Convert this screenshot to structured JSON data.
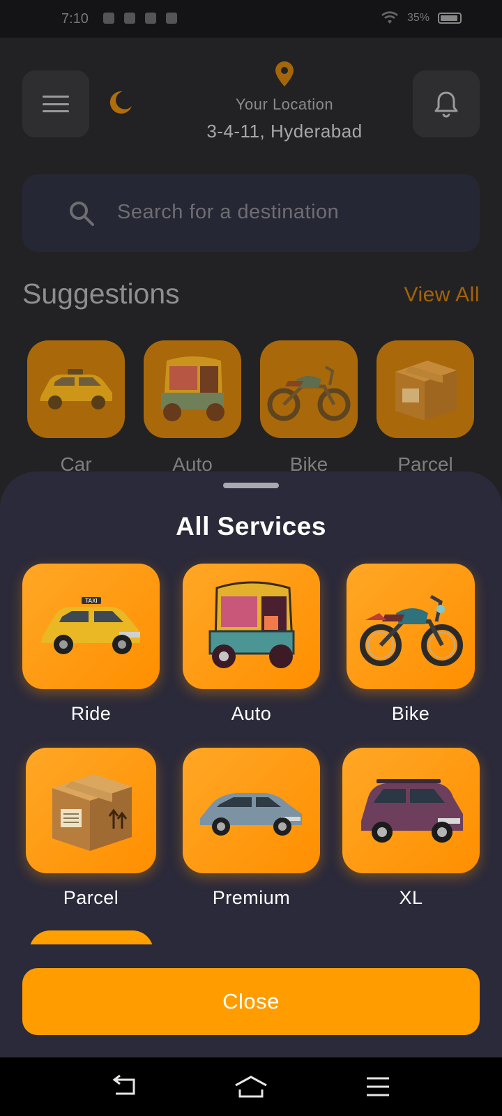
{
  "status_bar": {
    "time": "7:10",
    "battery": "35%"
  },
  "header": {
    "location_label": "Your Location",
    "location_address": "3-4-11, Hyderabad"
  },
  "search": {
    "placeholder": "Search for a destination"
  },
  "suggestions": {
    "title": "Suggestions",
    "view_all": "View All",
    "items": [
      {
        "label": "Car",
        "icon": "taxi-car-icon"
      },
      {
        "label": "Auto",
        "icon": "auto-rickshaw-icon"
      },
      {
        "label": "Bike",
        "icon": "motorbike-icon"
      },
      {
        "label": "Parcel",
        "icon": "parcel-box-icon"
      }
    ]
  },
  "sheet": {
    "title": "All Services",
    "services": [
      {
        "label": "Ride",
        "icon": "taxi-car-icon"
      },
      {
        "label": "Auto",
        "icon": "auto-rickshaw-icon"
      },
      {
        "label": "Bike",
        "icon": "motorbike-icon"
      },
      {
        "label": "Parcel",
        "icon": "parcel-box-icon"
      },
      {
        "label": "Premium",
        "icon": "sedan-car-icon"
      },
      {
        "label": "XL",
        "icon": "suv-car-icon"
      }
    ],
    "close_label": "Close"
  },
  "colors": {
    "accent": "#ff9d00",
    "sheet_bg": "#2b2a3a",
    "background": "#222224"
  }
}
